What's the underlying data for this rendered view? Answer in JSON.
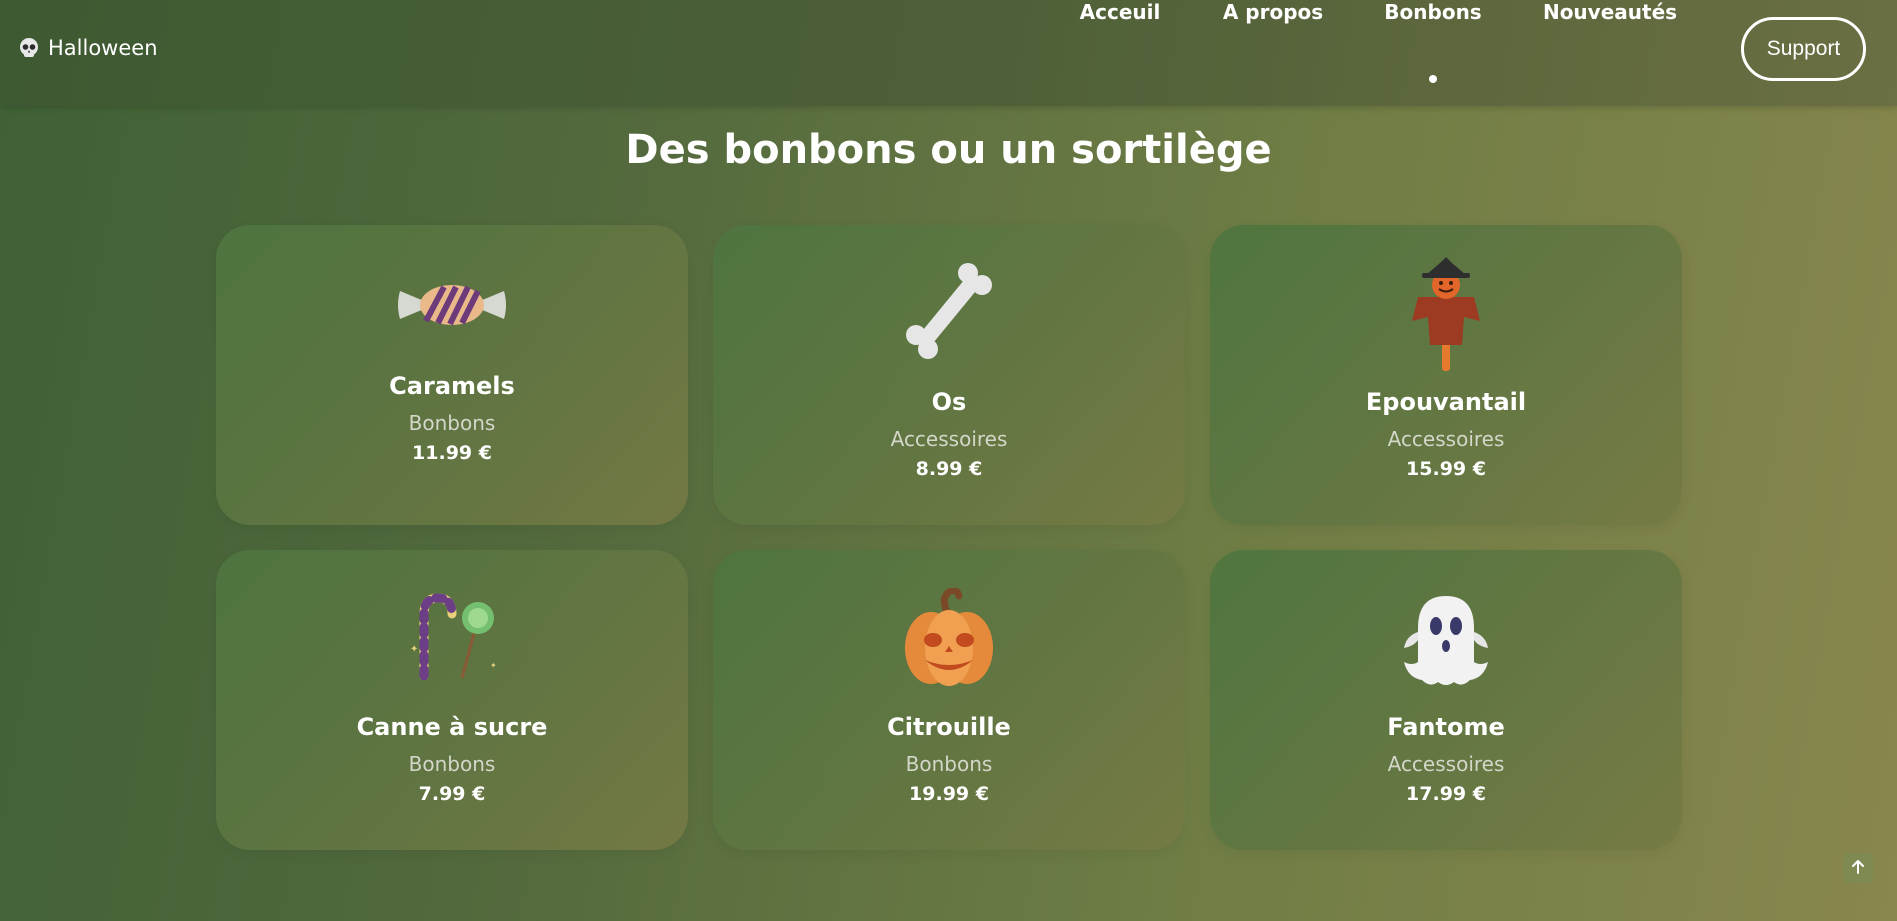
{
  "header": {
    "logo_text": "Halloween",
    "logo_icon": "skull-icon",
    "nav": [
      {
        "label": "Acceuil",
        "active": false
      },
      {
        "label": "A propos",
        "active": false
      },
      {
        "label": "Bonbons",
        "active": true
      },
      {
        "label": "Nouveautés",
        "active": false
      }
    ],
    "support_label": "Support"
  },
  "main": {
    "title": "Des bonbons ou un sortilège",
    "products": [
      {
        "name": "Caramels",
        "category": "Bonbons",
        "price": "11.99 €",
        "icon": "wrapped-candy-icon"
      },
      {
        "name": "Os",
        "category": "Accessoires",
        "price": "8.99 €",
        "icon": "bone-icon"
      },
      {
        "name": "Epouvantail",
        "category": "Accessoires",
        "price": "15.99 €",
        "icon": "scarecrow-icon"
      },
      {
        "name": "Canne à sucre",
        "category": "Bonbons",
        "price": "7.99 €",
        "icon": "candy-cane-icon"
      },
      {
        "name": "Citrouille",
        "category": "Bonbons",
        "price": "19.99 €",
        "icon": "pumpkin-icon"
      },
      {
        "name": "Fantome",
        "category": "Accessoires",
        "price": "17.99 €",
        "icon": "ghost-icon"
      }
    ]
  },
  "scroll_top_icon": "arrow-up-icon",
  "colors": {
    "text": "#ffffff",
    "category_text": "#d3d6c8",
    "background_start": "#3f6134",
    "background_end": "#88874d"
  }
}
